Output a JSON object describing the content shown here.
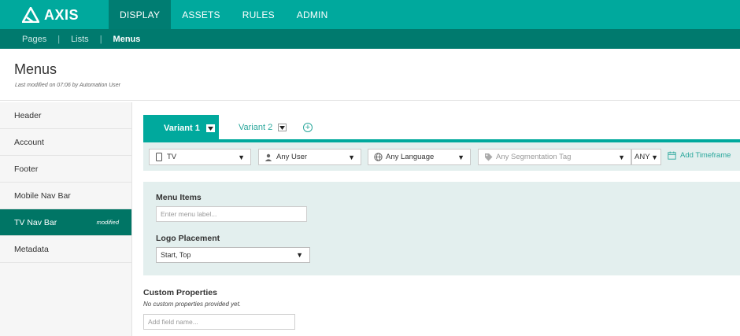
{
  "app": {
    "logo_text": "AXIS"
  },
  "topnav": [
    {
      "label": "DISPLAY",
      "active": true
    },
    {
      "label": "ASSETS",
      "active": false
    },
    {
      "label": "RULES",
      "active": false
    },
    {
      "label": "ADMIN",
      "active": false
    }
  ],
  "subnav": [
    {
      "label": "Pages",
      "active": false
    },
    {
      "label": "Lists",
      "active": false
    },
    {
      "label": "Menus",
      "active": true
    }
  ],
  "page": {
    "title": "Menus",
    "meta": "Last modified on 07:06 by Automation User"
  },
  "sidebar": {
    "items": [
      {
        "label": "Header",
        "badge": ""
      },
      {
        "label": "Account",
        "badge": ""
      },
      {
        "label": "Footer",
        "badge": ""
      },
      {
        "label": "Mobile Nav Bar",
        "badge": ""
      },
      {
        "label": "TV Nav Bar",
        "badge": "modified",
        "active": true
      },
      {
        "label": "Metadata",
        "badge": ""
      }
    ]
  },
  "variants": {
    "tabs": [
      {
        "label": "Variant 1",
        "active": true
      },
      {
        "label": "Variant 2",
        "active": false
      }
    ]
  },
  "filters": {
    "device": {
      "value": "TV",
      "icon": "tv-icon"
    },
    "user": {
      "value": "Any User",
      "icon": "user-icon"
    },
    "language": {
      "value": "Any Language",
      "icon": "globe-icon"
    },
    "segmentation": {
      "placeholder": "Any Segmentation Tag",
      "icon": "tag-icon"
    },
    "match": {
      "value": "ANY"
    },
    "timeframe_label": "Add Timeframe"
  },
  "menu_items": {
    "label": "Menu Items",
    "placeholder": "Enter menu label..."
  },
  "logo_placement": {
    "label": "Logo Placement",
    "value": "Start, Top"
  },
  "custom_properties": {
    "title": "Custom Properties",
    "note": "No custom properties provided yet.",
    "placeholder": "Add field name..."
  },
  "colors": {
    "primary": "#00a99d",
    "primary_dark": "#007a6e",
    "panel_bg": "#e3efee"
  }
}
